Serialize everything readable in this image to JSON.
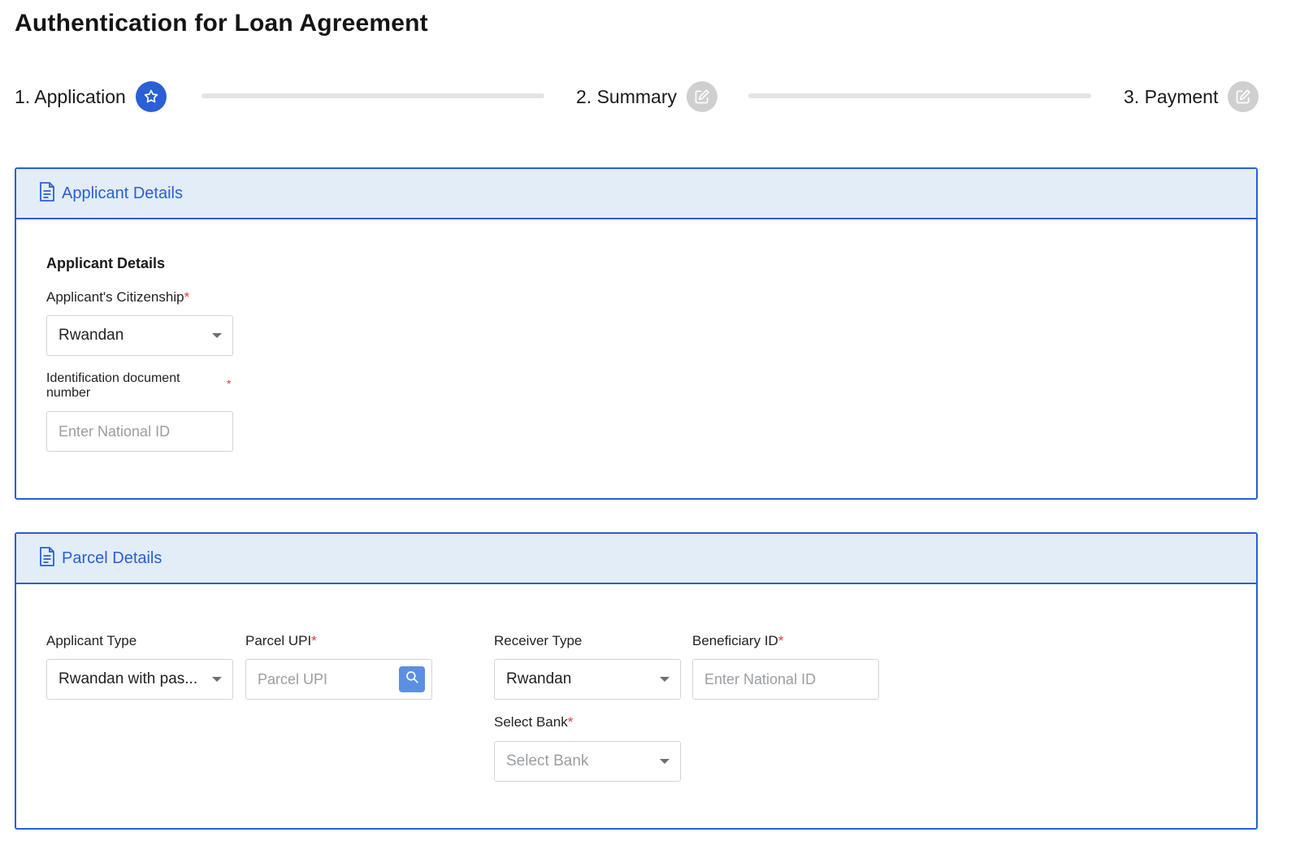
{
  "page": {
    "title": "Authentication for Loan Agreement"
  },
  "stepper": {
    "steps": [
      {
        "label": "1. Application",
        "state": "active",
        "icon": "star-icon"
      },
      {
        "label": "2. Summary",
        "state": "inactive",
        "icon": "edit-icon"
      },
      {
        "label": "3. Payment",
        "state": "inactive",
        "icon": "edit-icon"
      }
    ]
  },
  "applicant_panel": {
    "header": "Applicant Details",
    "section_title": "Applicant Details",
    "citizenship": {
      "label": "Applicant's Citizenship",
      "required_mark": "*",
      "value": "Rwandan"
    },
    "id_number": {
      "label": "Identification document number",
      "required_mark": "*",
      "placeholder": "Enter National ID"
    }
  },
  "parcel_panel": {
    "header": "Parcel Details",
    "applicant_type": {
      "label": "Applicant Type",
      "value": "Rwandan with pas..."
    },
    "parcel_upi": {
      "label": "Parcel UPI",
      "required_mark": "*",
      "placeholder": "Parcel UPI"
    },
    "receiver_type": {
      "label": "Receiver Type",
      "value": "Rwandan"
    },
    "beneficiary_id": {
      "label": "Beneficiary ID",
      "required_mark": "*",
      "placeholder": "Enter National ID"
    },
    "bank": {
      "label": "Select Bank",
      "required_mark": "*",
      "placeholder": "Select Bank"
    }
  },
  "colors": {
    "accent": "#2a5fd6",
    "header_bg": "#e2edf8",
    "required": "#e23b3b",
    "inactive_step": "#cfcfcf"
  }
}
